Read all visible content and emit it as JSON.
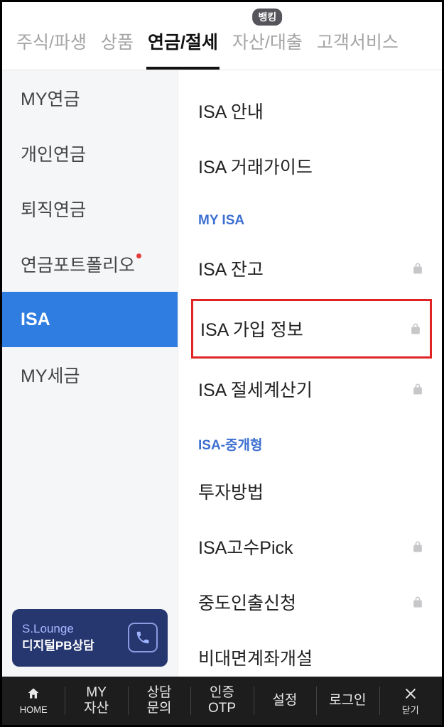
{
  "topTabs": [
    {
      "label": "주식/파생"
    },
    {
      "label": "상품"
    },
    {
      "label": "연금/절세",
      "active": true
    },
    {
      "label": "자산/대출",
      "badge": "뱅킹"
    },
    {
      "label": "고객서비스"
    }
  ],
  "sidebar": {
    "items": [
      {
        "label": "MY연금"
      },
      {
        "label": "개인연금"
      },
      {
        "label": "퇴직연금"
      },
      {
        "label": "연금포트폴리오",
        "dot": true
      },
      {
        "label": "ISA",
        "selected": true
      },
      {
        "label": "MY세금"
      }
    ],
    "lounge": {
      "title": "S.Lounge",
      "sub": "디지털PB상담"
    }
  },
  "content": [
    {
      "type": "item",
      "label": "ISA 안내"
    },
    {
      "type": "item",
      "label": "ISA 거래가이드"
    },
    {
      "type": "head",
      "label": "MY ISA"
    },
    {
      "type": "item",
      "label": "ISA 잔고",
      "lock": true
    },
    {
      "type": "item",
      "label": "ISA 가입 정보",
      "lock": true,
      "highlight": true
    },
    {
      "type": "item",
      "label": "ISA 절세계산기",
      "lock": true
    },
    {
      "type": "head",
      "label": "ISA-중개형"
    },
    {
      "type": "item",
      "label": "투자방법"
    },
    {
      "type": "item",
      "label": "ISA고수Pick",
      "lock": true
    },
    {
      "type": "item",
      "label": "중도인출신청",
      "lock": true
    },
    {
      "type": "item",
      "label": "비대면계좌개설"
    }
  ],
  "bottom": [
    {
      "key": "home",
      "label": "HOME",
      "icon": "home"
    },
    {
      "key": "my",
      "label": "MY\n자산"
    },
    {
      "key": "consult",
      "label": "상담\n문의"
    },
    {
      "key": "otp",
      "label": "인증\nOTP"
    },
    {
      "key": "settings",
      "label": "설정"
    },
    {
      "key": "login",
      "label": "로그인"
    },
    {
      "key": "close",
      "label": "닫기",
      "icon": "close"
    }
  ]
}
